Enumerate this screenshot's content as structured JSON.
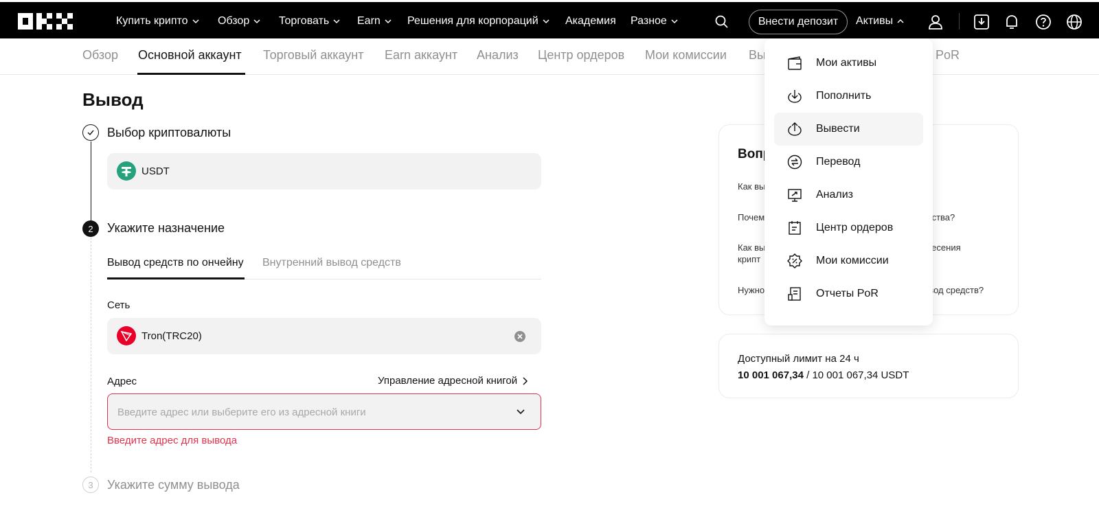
{
  "topnav": {
    "items": [
      {
        "label": "Купить крипто",
        "dropdown": true
      },
      {
        "label": "Обзор",
        "dropdown": true
      },
      {
        "label": "Торговать",
        "dropdown": true
      },
      {
        "label": "Earn",
        "dropdown": true
      },
      {
        "label": "Решения для корпораций",
        "dropdown": true
      },
      {
        "label": "Академия",
        "dropdown": false
      },
      {
        "label": "Разное",
        "dropdown": true
      }
    ],
    "deposit_label": "Внести депозит",
    "assets_label": "Активы"
  },
  "subnav": {
    "tabs": [
      {
        "label": "Обзор",
        "active": false
      },
      {
        "label": "Основной аккаунт",
        "active": true
      },
      {
        "label": "Торговый аккаунт",
        "active": false
      },
      {
        "label": "Earn аккаунт",
        "active": false
      },
      {
        "label": "Анализ",
        "active": false
      },
      {
        "label": "Центр ордеров",
        "active": false
      },
      {
        "label": "Мои комиссии",
        "active": false
      },
      {
        "label": "Вы",
        "active": false
      },
      {
        "label": "PoR",
        "active": false
      }
    ]
  },
  "page": {
    "title": "Вывод",
    "step1": {
      "title": "Выбор криптовалюты",
      "coin": "USDT"
    },
    "step2": {
      "number": "2",
      "title": "Укажите назначение",
      "tabs": [
        "Вывод средств по ончейну",
        "Внутренний вывод средств"
      ],
      "network_label": "Сеть",
      "network_value": "Tron(TRC20)",
      "address_label": "Адрес",
      "address_book_link": "Управление адресной книгой",
      "address_placeholder": "Введите адрес или выберите его из адресной книги",
      "address_error": "Введите адрес для вывода"
    },
    "step3": {
      "number": "3",
      "title": "Укажите сумму вывода"
    }
  },
  "faq": {
    "title": "Вопр",
    "items": [
      {
        "left": "Как вы",
        "right": ""
      },
      {
        "left": "Почем",
        "right": "дства?"
      },
      {
        "left": "Как вы",
        "left2": "крипт",
        "right": "несения"
      },
      {
        "left": "Нужно",
        "right": "ывод средств?"
      }
    ]
  },
  "limit": {
    "title": "Доступный лимит на 24 ч",
    "used": "10 001 067,34",
    "separator": " / ",
    "total": "10 001 067,34 USDT"
  },
  "dropdown_menu": {
    "items": [
      {
        "label": "Мои активы",
        "icon": "wallet-icon"
      },
      {
        "label": "Пополнить",
        "icon": "deposit-icon"
      },
      {
        "label": "Вывести",
        "icon": "withdraw-icon",
        "hover": true
      },
      {
        "label": "Перевод",
        "icon": "transfer-icon"
      },
      {
        "label": "Анализ",
        "icon": "analysis-icon"
      },
      {
        "label": "Центр ордеров",
        "icon": "order-center-icon"
      },
      {
        "label": "Мои комиссии",
        "icon": "fees-icon"
      },
      {
        "label": "Отчеты PoR",
        "icon": "por-report-icon"
      }
    ]
  },
  "colors": {
    "nav_bg": "#000000",
    "error": "#e0334d",
    "tether": "#26a17b",
    "tron": "#eb0029",
    "field_bg": "#f2f2f2"
  }
}
